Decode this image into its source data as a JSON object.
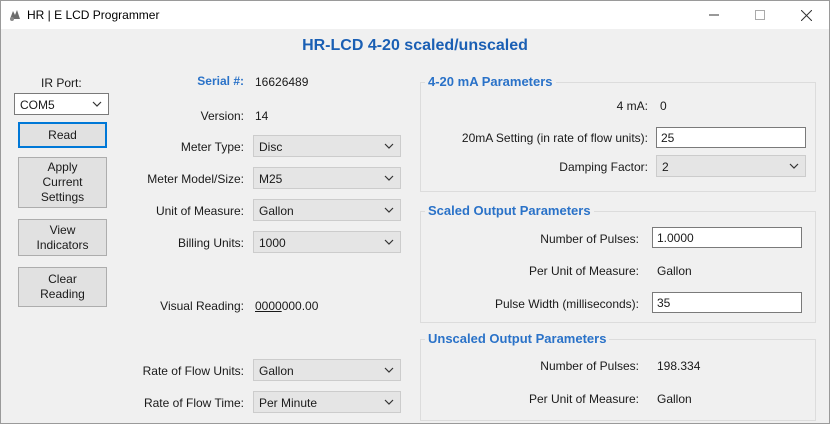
{
  "window": {
    "title": "HR | E LCD Programmer"
  },
  "heading": "HR-LCD 4-20 scaled/unscaled",
  "left_panel": {
    "ir_port_label": "IR Port:",
    "ir_port_value": "COM5",
    "buttons": {
      "read": "Read",
      "apply": "Apply\nCurrent\nSettings",
      "view": "View\nIndicators",
      "clear": "Clear\nReading"
    }
  },
  "meter": {
    "serial_label": "Serial #:",
    "serial_value": "16626489",
    "version_label": "Version:",
    "version_value": "14",
    "meter_type_label": "Meter Type:",
    "meter_type_value": "Disc",
    "model_label": "Meter Model/Size:",
    "model_value": "M25",
    "uom_label": "Unit of Measure:",
    "uom_value": "Gallon",
    "billing_label": "Billing Units:",
    "billing_value": "1000",
    "visual_label": "Visual Reading:",
    "visual_value_underlined": "0000",
    "visual_value_rest": "000.00",
    "rate_units_label": "Rate of Flow Units:",
    "rate_units_value": "Gallon",
    "rate_time_label": "Rate of Flow Time:",
    "rate_time_value": "Per Minute"
  },
  "ma_params": {
    "title": "4-20 mA Parameters",
    "four_ma_label": "4 mA:",
    "four_ma_value": "0",
    "twenty_ma_label": "20mA Setting (in rate of flow units):",
    "twenty_ma_value": "25",
    "damping_label": "Damping Factor:",
    "damping_value": "2"
  },
  "scaled": {
    "title": "Scaled Output Parameters",
    "pulses_label": "Number of Pulses:",
    "pulses_value": "1.0000",
    "per_unit_label": "Per Unit of Measure:",
    "per_unit_value": "Gallon",
    "pulse_width_label": "Pulse Width (milliseconds):",
    "pulse_width_value": "35"
  },
  "unscaled": {
    "title": "Unscaled Output Parameters",
    "pulses_label": "Number of Pulses:",
    "pulses_value": "198.334",
    "per_unit_label": "Per Unit of Measure:",
    "per_unit_value": "Gallon"
  }
}
